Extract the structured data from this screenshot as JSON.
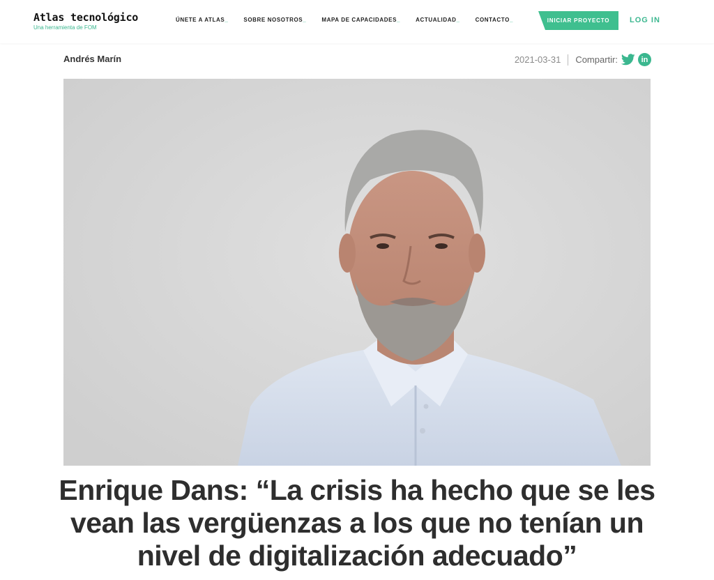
{
  "header": {
    "logo_title": "Atlas tecnológico",
    "logo_subtitle": "Una herramienta de FOM",
    "nav": [
      {
        "label": "ÚNETE A ATLAS"
      },
      {
        "label": "SOBRE NOSOTROS"
      },
      {
        "label": "MAPA DE CAPACIDADES"
      },
      {
        "label": "ACTUALIDAD"
      },
      {
        "label": "CONTACTO"
      }
    ],
    "cta_label": "INICIAR PROYECTO",
    "login_label": "LOG IN"
  },
  "article": {
    "author": "Andrés Marín",
    "date": "2021-03-31",
    "share_label": "Compartir:",
    "share_icons": [
      "twitter-icon",
      "linkedin-icon"
    ],
    "linkedin_glyph": "in",
    "headline": "Enrique Dans: “La crisis ha hecho que se les vean las vergüenzas a los que no tenían un nivel de digitalización adecuado”"
  },
  "colors": {
    "accent": "#3bb78f",
    "text": "#2e2e2e",
    "photo_background": "#d9d9d9"
  }
}
